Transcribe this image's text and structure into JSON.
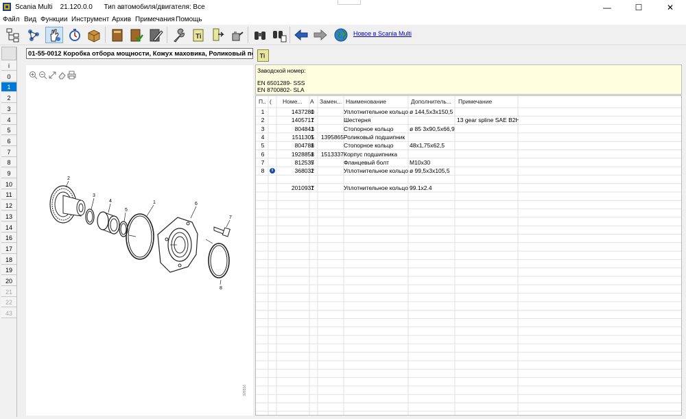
{
  "window": {
    "title": "Scania Multi    21.120.0.0      Тип автомобиля/двигателя: Все",
    "minimize": "—",
    "maximize": "☐",
    "close": "✕"
  },
  "menu": [
    "Файл",
    "Вид",
    "Функции",
    "Инструмент",
    "Архив",
    "Примечания",
    "Помощь"
  ],
  "toolbar": {
    "buttons": [
      "tree-icon",
      "network-icon",
      "hand-icon",
      "stopwatch-icon",
      "box-icon",
      "book-icon",
      "book-check-icon",
      "book-pen-icon",
      "wrench-icon",
      "notes-icon",
      "pointer-icon",
      "oil-can-icon",
      "binoculars-icon",
      "binoculars-doc-icon",
      "arrow-left-icon",
      "arrow-right-icon",
      "globe-icon"
    ],
    "news_link": "Новое в Scania Multi"
  },
  "left_nav": {
    "items": [
      "i",
      "0",
      "1",
      "2",
      "3",
      "4",
      "5",
      "6",
      "7",
      "8",
      "9",
      "10",
      "11",
      "12",
      "13",
      "14",
      "16",
      "17",
      "18",
      "19",
      "20",
      "21",
      "22",
      "43"
    ],
    "active_index": 2,
    "disabled_from": 21
  },
  "drawing": {
    "caption": "01-55-0012 Коробка отбора мощности, Кожух маховика, Роликовый подшип",
    "callouts": [
      "1",
      "2",
      "3",
      "4",
      "5",
      "6",
      "7",
      "8"
    ],
    "drawing_id": "326516"
  },
  "factory": {
    "label": "Заводской номер:",
    "numbers": [
      "EN 6501289- SSS",
      "EN 8700802- SLA"
    ]
  },
  "table": {
    "headers": [
      "П..",
      "(",
      "Номе...",
      "А",
      "Замен...",
      "Наименование",
      "Дополнитель...",
      "Примечание"
    ],
    "rows": [
      {
        "pos": "1",
        "info": "",
        "num": "1437280",
        "qty": "1",
        "repl": "",
        "name": "Уплотнительное кольцо",
        "extra": "ø 144,5x3x150,5",
        "note": ""
      },
      {
        "pos": "2",
        "info": "",
        "num": "1405717",
        "qty": "1",
        "repl": "",
        "name": "Шестерня",
        "extra": "",
        "note": "13 gear spline SAE B2H"
      },
      {
        "pos": "3",
        "info": "",
        "num": "804843",
        "qty": "1",
        "repl": "",
        "name": "Стопорное кольцо",
        "extra": "ø 85 3x90,5x66,9",
        "note": ""
      },
      {
        "pos": "4",
        "info": "",
        "num": "1511305",
        "qty": "1",
        "repl": "1395865",
        "name": "Роликовый подшипник",
        "extra": "",
        "note": ""
      },
      {
        "pos": "5",
        "info": "",
        "num": "804788",
        "qty": "1",
        "repl": "",
        "name": "Стопорное кольцо",
        "extra": "48x1,75x62,5",
        "note": ""
      },
      {
        "pos": "6",
        "info": "",
        "num": "1928858",
        "qty": "1",
        "repl": "1513337",
        "name": "Корпус подшипника",
        "extra": "",
        "note": ""
      },
      {
        "pos": "7",
        "info": "",
        "num": "812537",
        "qty": "5",
        "repl": "",
        "name": "Фланцевый болт",
        "extra": "M10x30",
        "note": ""
      },
      {
        "pos": "8",
        "info": "i",
        "num": "368032",
        "qty": "1",
        "repl": "",
        "name": "Уплотнительное кольцо",
        "extra": "ø 99,5x3x105,5",
        "note": ""
      },
      {
        "pos": "",
        "info": "",
        "num": "",
        "qty": "",
        "repl": "",
        "name": "",
        "extra": "",
        "note": ""
      },
      {
        "pos": "",
        "info": "",
        "num": "2010937",
        "qty": "1",
        "repl": "",
        "name": "Уплотнительное кольцо",
        "extra": "99.1x2.4",
        "note": ""
      }
    ]
  },
  "colors": {
    "accent": "#0078d7",
    "factory_bg": "#ffffe0",
    "link": "#0000cc"
  }
}
